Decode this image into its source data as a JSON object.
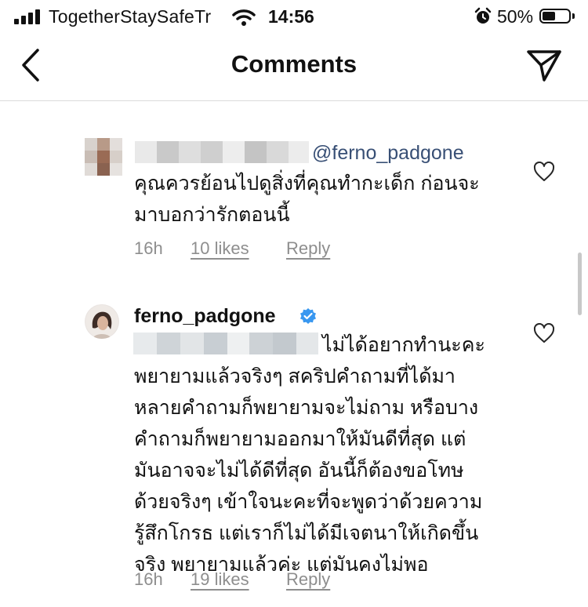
{
  "status_bar": {
    "carrier": "TogetherStaySafeTr",
    "time": "14:56",
    "battery_percent": "50%",
    "battery_level": 0.5
  },
  "header": {
    "title": "Comments",
    "back_icon": "chevron-left-icon",
    "send_icon": "paper-plane-icon"
  },
  "comments": [
    {
      "mention": "@ferno_padgone",
      "text_lines": [
        "คุณควรย้อนไปดูสิ่งที่คุณทำกะเด็ก ก่อนจะ",
        "มาบอกว่ารักตอนนี้"
      ],
      "time": "16h",
      "likes": "10 likes",
      "reply": "Reply"
    },
    {
      "username": "ferno_padgone",
      "verified": true,
      "text_lines": [
        "ไม่ได้อยากทำนะคะ",
        "พยายามแล้วจริงๆ สคริปคำถามที่ได้มา",
        "หลายคำถามก็พยายามจะไม่ถาม หรือบาง",
        "คำถามก็พยายามออกมาให้มันดีที่สุด แต่",
        "มันอาจจะไม่ได้ดีที่สุด อันนี้ก็ต้องขอโทษ",
        "ด้วยจริงๆ เข้าใจนะคะที่จะพูดว่าด้วยความ",
        "รู้สึกโกรธ แต่เราก็ไม่ได้มีเจตนาให้เกิดขึ้น",
        "จริง พยายามแล้วค่ะ แต่มันคงไม่พอ"
      ],
      "time": "16h",
      "likes": "19 likes",
      "reply": "Reply"
    }
  ],
  "colors": {
    "mention": "#384f75",
    "meta": "#8e8e8e",
    "verified": "#3897f0",
    "divider": "#dbdbdb"
  }
}
